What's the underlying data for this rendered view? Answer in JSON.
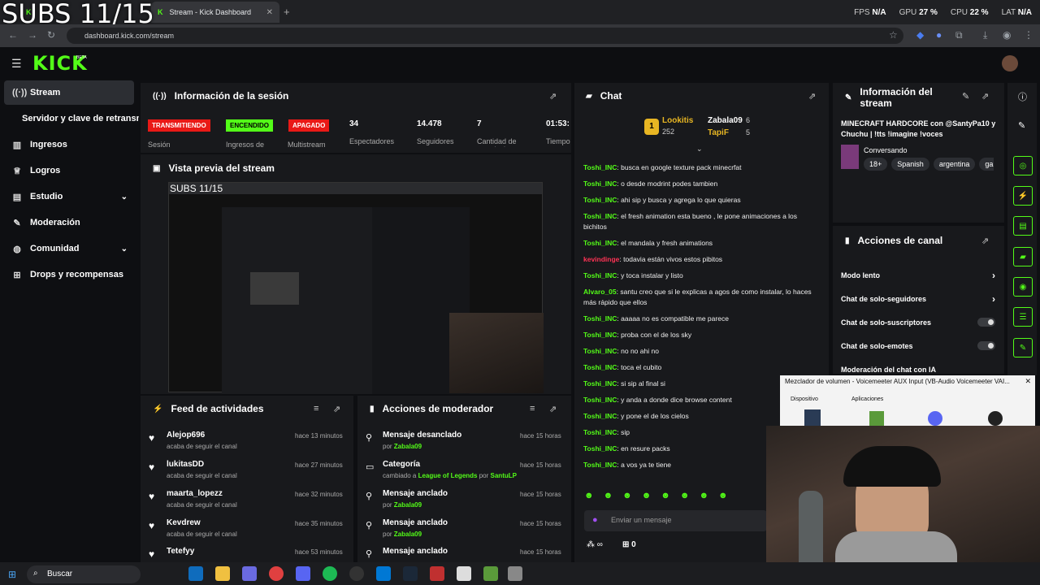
{
  "overlay": {
    "text": "SUBS 11/15"
  },
  "perf": {
    "fps_label": "FPS",
    "fps": "N/A",
    "gpu_label": "GPU",
    "gpu": "27 %",
    "cpu_label": "CPU",
    "cpu": "22 %",
    "lat_label": "LAT",
    "lat": "N/A"
  },
  "browser": {
    "tabs": [
      {
        "title": "Stream - Kick Dashboard"
      }
    ],
    "url": "dashboard.kick.com/stream"
  },
  "kick": {
    "logo": "KICK",
    "beta": "BETA"
  },
  "sidebar": {
    "items": [
      {
        "label": "Stream",
        "icon": "broadcast-icon"
      },
      {
        "label": "Servidor y clave de retransmisión"
      },
      {
        "label": "Ingresos",
        "icon": "chart-icon"
      },
      {
        "label": "Logros",
        "icon": "trophy-icon"
      },
      {
        "label": "Estudio",
        "icon": "studio-icon"
      },
      {
        "label": "Moderación",
        "icon": "wrench-icon"
      },
      {
        "label": "Comunidad",
        "icon": "users-icon"
      },
      {
        "label": "Drops y recompensas",
        "icon": "gift-icon"
      }
    ]
  },
  "session": {
    "title": "Información de la sesión",
    "badges": [
      {
        "text": "TRANSMITIENDO",
        "label": "Sesión",
        "color": "#e91916"
      },
      {
        "text": "ENCENDIDO",
        "label": "Ingresos de",
        "color": "#53fc18"
      },
      {
        "text": "APAGADO",
        "label": "Multistream",
        "color": "#e91916"
      }
    ],
    "stats": [
      {
        "value": "34",
        "label": "Espectadores"
      },
      {
        "value": "14.478",
        "label": "Seguidores"
      },
      {
        "value": "7",
        "label": "Cantidad de suscripciones"
      },
      {
        "value": "01:53:",
        "label": "Tiempo"
      }
    ]
  },
  "preview": {
    "title": "Vista previa del stream"
  },
  "feed": {
    "title": "Feed de actividades",
    "items": [
      {
        "name": "Alejop696",
        "sub": "acaba de seguir el canal",
        "time": "hace 13 minutos"
      },
      {
        "name": "lukitasDD",
        "sub": "acaba de seguir el canal",
        "time": "hace 27 minutos"
      },
      {
        "name": "maarta_lopezz",
        "sub": "acaba de seguir el canal",
        "time": "hace 32 minutos"
      },
      {
        "name": "Kevdrew",
        "sub": "acaba de seguir el canal",
        "time": "hace 35 minutos"
      },
      {
        "name": "Tetefyy",
        "sub": "",
        "time": "hace 53 minutos"
      }
    ]
  },
  "modactions": {
    "title": "Acciones de moderador",
    "items": [
      {
        "name": "Mensaje desanclado",
        "pre": "por ",
        "user": "Zabala09",
        "time": "hace 15 horas"
      },
      {
        "name": "Categoría",
        "pre": "cambiado a ",
        "user": "League of Legends",
        "mid": " por ",
        "user2": "SantuLP",
        "time": "hace 15 horas"
      },
      {
        "name": "Mensaje anclado",
        "pre": "por ",
        "user": "Zabala09",
        "time": "hace 15 horas"
      },
      {
        "name": "Mensaje anclado",
        "pre": "por ",
        "user": "Zabala09",
        "time": "hace 15 horas"
      },
      {
        "name": "Mensaje anclado",
        "pre": "",
        "user": "",
        "time": "hace 15 horas"
      }
    ]
  },
  "chat": {
    "title": "Chat",
    "leaders": [
      {
        "name": "Lookitis",
        "count": "252"
      },
      {
        "name": "Zabala09",
        "count": "6"
      },
      {
        "name": "TapiF",
        "count": "5"
      }
    ],
    "messages": [
      {
        "user": "Toshi_INC",
        "text": "busca en google texture pack minecrfat",
        "color": "#53fc18"
      },
      {
        "user": "Toshi_INC",
        "text": "o desde modrint podes tambien",
        "color": "#53fc18"
      },
      {
        "user": "Toshi_INC",
        "text": "ahi sip y busca y agrega lo que quieras",
        "color": "#53fc18"
      },
      {
        "user": "Toshi_INC",
        "text": "el fresh animation esta bueno , le pone animaciones a los bichitos",
        "color": "#53fc18"
      },
      {
        "user": "Toshi_INC",
        "text": "el mandala y fresh animations",
        "color": "#53fc18"
      },
      {
        "user": "kevindinge",
        "text": "todavia están vivos estos pibitos",
        "color": "#ff3355"
      },
      {
        "user": "Toshi_INC",
        "text": "y toca instalar y listo",
        "color": "#53fc18"
      },
      {
        "user": "Alvaro_05",
        "text": "santu creo que si le explicas a agos de como instalar, lo haces más rápido que ellos",
        "color": "#53fc18"
      },
      {
        "user": "Toshi_INC",
        "text": "aaaaa no es compatible me parece",
        "color": "#53fc18"
      },
      {
        "user": "Toshi_INC",
        "text": "proba con el de los sky",
        "color": "#53fc18"
      },
      {
        "user": "Toshi_INC",
        "text": "no no ahi no",
        "color": "#53fc18"
      },
      {
        "user": "Toshi_INC",
        "text": "toca el cubito",
        "color": "#53fc18"
      },
      {
        "user": "Toshi_INC",
        "text": "si sip al final si",
        "color": "#53fc18"
      },
      {
        "user": "Toshi_INC",
        "text": "y anda a donde dice browse content",
        "color": "#53fc18"
      },
      {
        "user": "Toshi_INC",
        "text": "y pone el de los cielos",
        "color": "#53fc18"
      },
      {
        "user": "Toshi_INC",
        "text": "sip",
        "color": "#53fc18"
      },
      {
        "user": "Toshi_INC",
        "text": "en resure packs",
        "color": "#53fc18"
      },
      {
        "user": "Toshi_INC",
        "text": "a vos ya te tiene",
        "color": "#53fc18"
      }
    ],
    "input_placeholder": "Enviar un mensaje",
    "infinity": "∞",
    "gift_count": "0"
  },
  "streaminfo": {
    "title": "Información del stream",
    "text": "MINECRAFT HARDCORE con @SantyPa10 y Chuchu | !tts !imagine !voces",
    "category": "Conversando",
    "tags": [
      "18+",
      "Spanish",
      "argentina",
      "gar"
    ]
  },
  "channelactions": {
    "title": "Acciones de canal",
    "items": [
      {
        "label": "Modo lento",
        "ctrl": "chevron"
      },
      {
        "label": "Chat de solo-seguidores",
        "ctrl": "chevron"
      },
      {
        "label": "Chat de solo-suscriptores",
        "ctrl": "toggle"
      },
      {
        "label": "Chat de solo-emotes",
        "ctrl": "toggle"
      },
      {
        "label": "Moderación del chat con IA",
        "ctrl": "external"
      }
    ]
  },
  "mixer": {
    "title": "Mezclador de volumen - Voicemeeter AUX Input (VB-Audio Voicemeeter VAI...",
    "device": "Dispositivo",
    "apps": "Aplicaciones"
  },
  "taskbar": {
    "search": "Buscar"
  },
  "colors": {
    "accent": "#53fc18",
    "live": "#e91916",
    "panel": "#18191c"
  }
}
